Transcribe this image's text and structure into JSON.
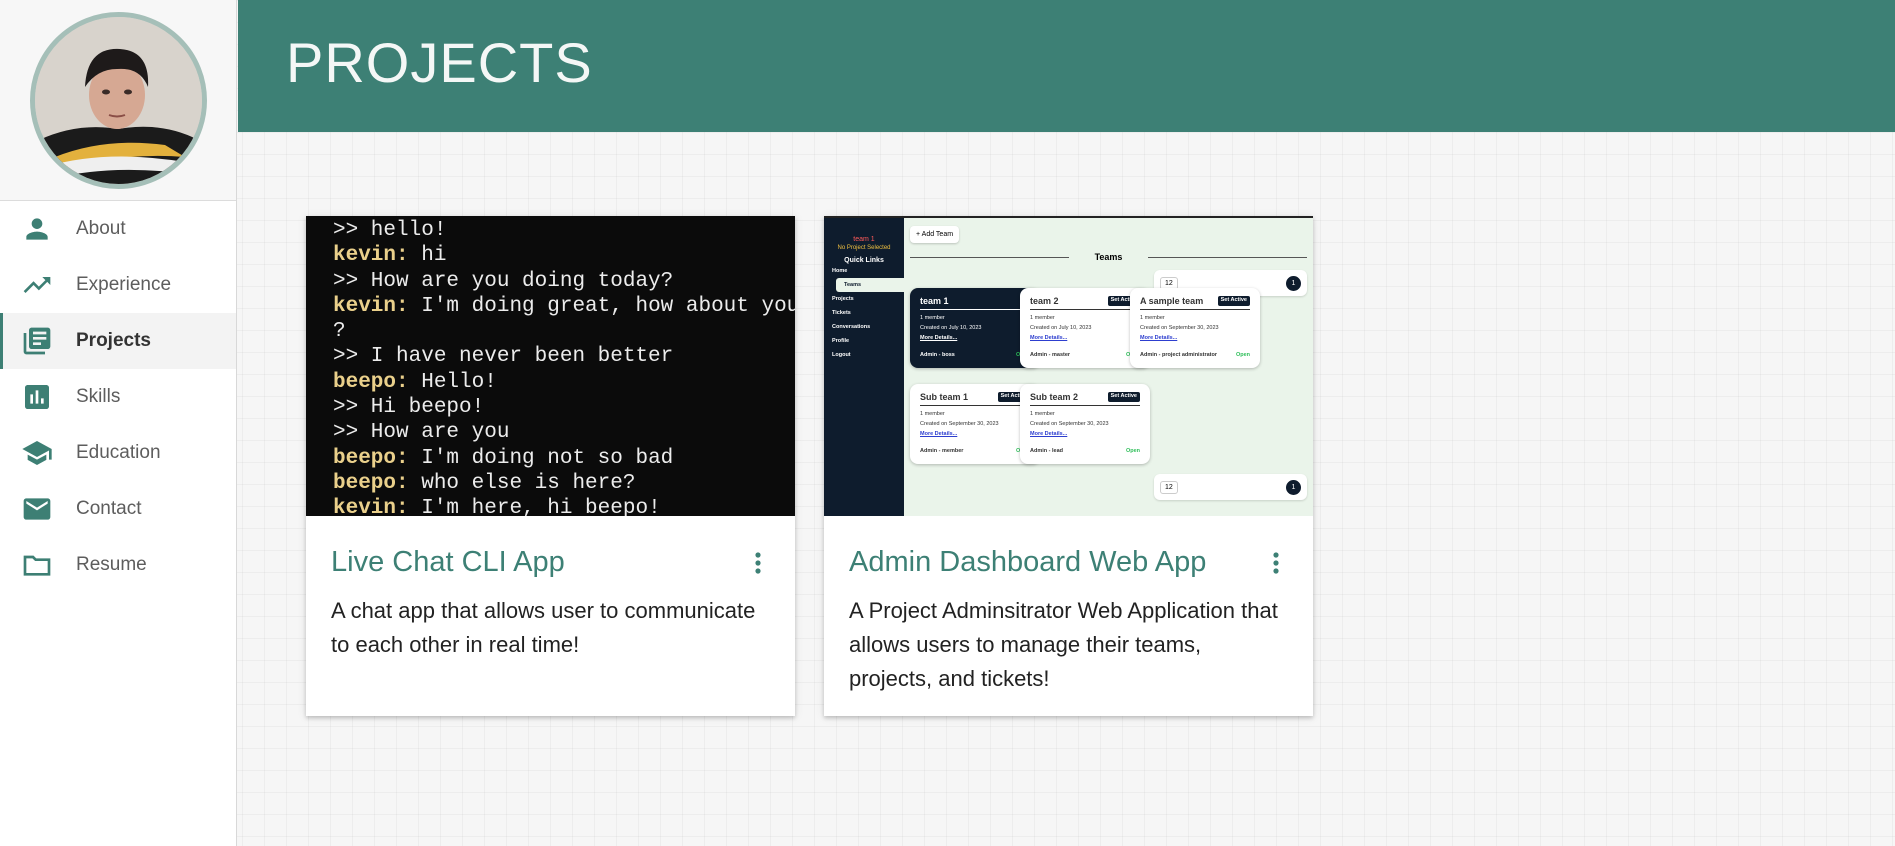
{
  "sidebar": {
    "avatar_alt": "profile photo",
    "items": [
      {
        "label": "About",
        "icon": "person-icon"
      },
      {
        "label": "Experience",
        "icon": "trending-up-icon"
      },
      {
        "label": "Projects",
        "icon": "library-books-icon",
        "active": true
      },
      {
        "label": "Skills",
        "icon": "bar-chart-icon"
      },
      {
        "label": "Education",
        "icon": "school-icon"
      },
      {
        "label": "Contact",
        "icon": "mail-icon"
      },
      {
        "label": "Resume",
        "icon": "folder-icon"
      }
    ]
  },
  "header": {
    "title": "PROJECTS"
  },
  "colors": {
    "accent": "#3d8075",
    "header_bg": "#3d8075",
    "terminal_name": "#ead08b"
  },
  "projects": [
    {
      "title": "Live Chat CLI App",
      "description": "A chat app that allows user to communicate to each other in real time!",
      "terminal": [
        {
          "who": "",
          "text": ">> hello!"
        },
        {
          "who": "kevin:",
          "text": " hi"
        },
        {
          "who": "",
          "text": ">> How are you doing today?"
        },
        {
          "who": "kevin:",
          "text": " I'm doing great, how about you"
        },
        {
          "who": "",
          "text": "?"
        },
        {
          "who": "",
          "text": ">> I have never been better"
        },
        {
          "who": "beepo:",
          "text": " Hello!"
        },
        {
          "who": "",
          "text": ">> Hi beepo!"
        },
        {
          "who": "",
          "text": ">> How are you"
        },
        {
          "who": "beepo:",
          "text": " I'm doing not so bad"
        },
        {
          "who": "beepo:",
          "text": " who else is here?"
        },
        {
          "who": "kevin:",
          "text": " I'm here, hi beepo!"
        }
      ]
    },
    {
      "title": "Admin Dashboard Web App",
      "description": "A Project Adminsitrator Web Application that allows users to manage their teams, projects, and tickets!",
      "dashboard": {
        "team": "team 1",
        "no_project": "No Project Selected",
        "quick_links": "Quick Links",
        "links": [
          "Home",
          "Teams",
          "Projects",
          "Tickets",
          "Conversations",
          "Profile",
          "Logout"
        ],
        "add_team": "+ Add Team",
        "section": "Teams",
        "per_page": "12",
        "page": "1",
        "set_active": "Set Active",
        "more_details": "More Details...",
        "open": "Open",
        "members": "1 member",
        "cards": [
          {
            "name": "team 1",
            "created": "Created on July 10, 2023",
            "role": "Admin - boss"
          },
          {
            "name": "team 2",
            "created": "Created on July 10, 2023",
            "role": "Admin - master"
          },
          {
            "name": "A sample team",
            "created": "Created on September 30, 2023",
            "role": "Admin - project administrator"
          },
          {
            "name": "Sub team 1",
            "created": "Created on September 30, 2023",
            "role": "Admin - member"
          },
          {
            "name": "Sub team 2",
            "created": "Created on September 30, 2023",
            "role": "Admin - lead"
          }
        ]
      }
    }
  ]
}
